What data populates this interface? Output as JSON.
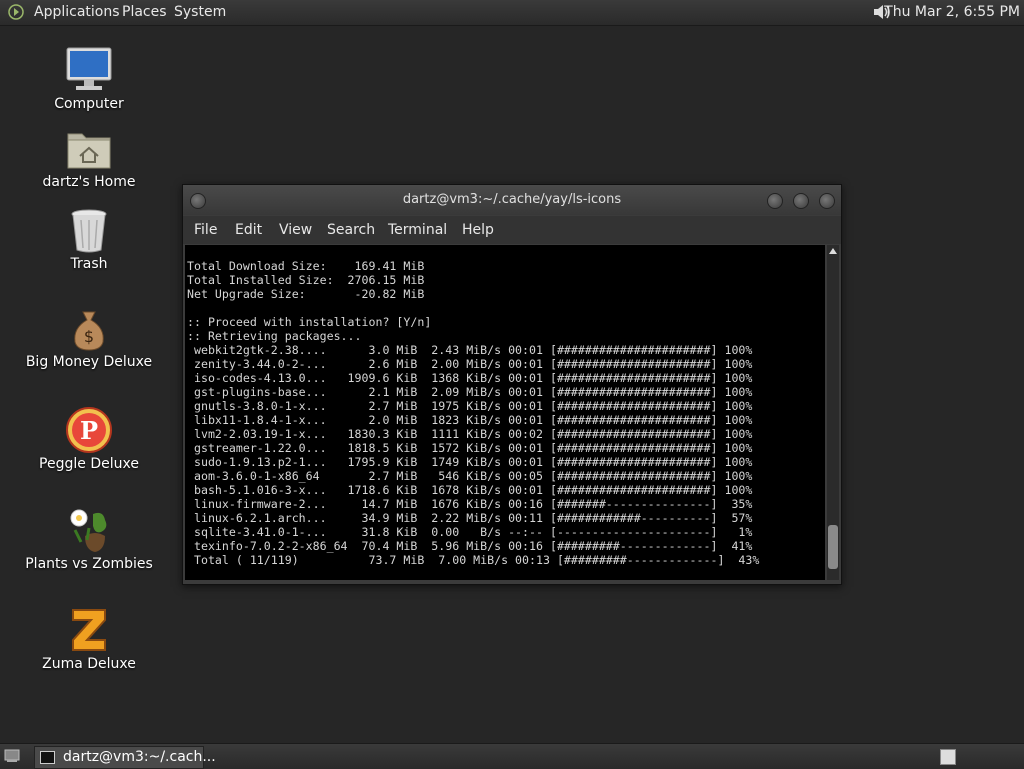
{
  "top_panel": {
    "menus": [
      "Applications",
      "Places",
      "System"
    ],
    "clock": "Thu Mar  2,  6:55 PM"
  },
  "desktop_icons": [
    {
      "label": "Computer",
      "icon": "computer-icon"
    },
    {
      "label": "dartz's Home",
      "icon": "home-folder-icon"
    },
    {
      "label": "Trash",
      "icon": "trash-icon"
    },
    {
      "label": "Big Money Deluxe",
      "icon": "money-bag-icon"
    },
    {
      "label": "Peggle Deluxe",
      "icon": "peggle-icon"
    },
    {
      "label": "Plants vs Zombies",
      "icon": "plants-vs-zombies-icon"
    },
    {
      "label": "Zuma Deluxe",
      "icon": "zuma-icon"
    }
  ],
  "terminal": {
    "title": "dartz@vm3:~/.cache/yay/ls-icons",
    "menus": [
      "File",
      "Edit",
      "View",
      "Search",
      "Terminal",
      "Help"
    ],
    "lines": [
      "Total Download Size:    169.41 MiB",
      "Total Installed Size:  2706.15 MiB",
      "Net Upgrade Size:       -20.82 MiB",
      "",
      ":: Proceed with installation? [Y/n]",
      ":: Retrieving packages...",
      " webkit2gtk-2.38....      3.0 MiB  2.43 MiB/s 00:01 [######################] 100%",
      " zenity-3.44.0-2-...      2.6 MiB  2.00 MiB/s 00:01 [######################] 100%",
      " iso-codes-4.13.0...   1909.6 KiB  1368 KiB/s 00:01 [######################] 100%",
      " gst-plugins-base...      2.1 MiB  2.09 MiB/s 00:01 [######################] 100%",
      " gnutls-3.8.0-1-x...      2.7 MiB  1975 KiB/s 00:01 [######################] 100%",
      " libx11-1.8.4-1-x...      2.0 MiB  1823 KiB/s 00:01 [######################] 100%",
      " lvm2-2.03.19-1-x...   1830.3 KiB  1111 KiB/s 00:02 [######################] 100%",
      " gstreamer-1.22.0...   1818.5 KiB  1572 KiB/s 00:01 [######################] 100%",
      " sudo-1.9.13.p2-1...   1795.9 KiB  1749 KiB/s 00:01 [######################] 100%",
      " aom-3.6.0-1-x86_64       2.7 MiB   546 KiB/s 00:05 [######################] 100%",
      " bash-5.1.016-3-x...   1718.6 KiB  1678 KiB/s 00:01 [######################] 100%",
      " linux-firmware-2...     14.7 MiB  1676 KiB/s 00:16 [#######---------------]  35%",
      " linux-6.2.1.arch...     34.9 MiB  2.22 MiB/s 00:11 [############----------]  57%",
      " sqlite-3.41.0-1-...     31.8 KiB  0.00   B/s --:-- [----------------------]   1%",
      " texinfo-7.0.2-2-x86_64  70.4 MiB  5.96 MiB/s 00:16 [#########-------------]  41%",
      " Total ( 11/119)          73.7 MiB  7.00 MiB/s 00:13 [#########-------------]  43%"
    ]
  },
  "bottom_panel": {
    "task_label": "dartz@vm3:~/.cach..."
  }
}
